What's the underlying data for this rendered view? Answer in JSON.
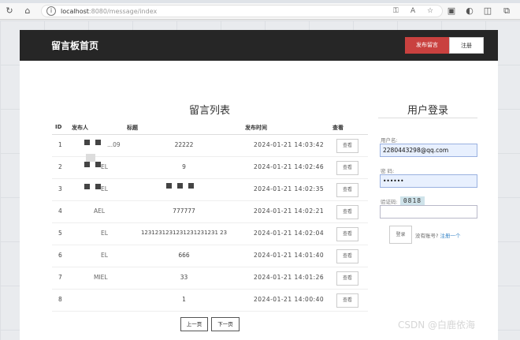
{
  "browser": {
    "url_host": "localhost",
    "url_rest": ":8080/message/index"
  },
  "site": {
    "brand": "留言板首页",
    "post_button": "发布留言",
    "register_button": "注册"
  },
  "list": {
    "title": "留言列表",
    "headers": {
      "id": "ID",
      "user": "发布人",
      "title": "标题",
      "time": "发布时间",
      "view": "查看"
    },
    "rows": [
      {
        "id": "1",
        "user": "...09",
        "title": "22222",
        "time": "2024-01-21 14:03:42",
        "view": "查看"
      },
      {
        "id": "2",
        "user": "EL",
        "title": "9",
        "time": "2024-01-21 14:02:46",
        "view": "查看"
      },
      {
        "id": "3",
        "user": "EL",
        "title": "",
        "time": "2024-01-21 14:02:35",
        "view": "查看"
      },
      {
        "id": "4",
        "user": "AEL",
        "title": "777777",
        "time": "2024-01-21 14:02:21",
        "view": "查看"
      },
      {
        "id": "5",
        "user": "EL",
        "title": "1231231231231231231231 23",
        "time": "2024-01-21 14:02:04",
        "view": "查看"
      },
      {
        "id": "6",
        "user": "EL",
        "title": "666",
        "time": "2024-01-21 14:01:40",
        "view": "查看"
      },
      {
        "id": "7",
        "user": "MIEL",
        "title": "33",
        "time": "2024-01-21 14:01:26",
        "view": "查看"
      },
      {
        "id": "8",
        "user": "",
        "title": "1",
        "time": "2024-01-21 14:00:40",
        "view": "查看"
      }
    ],
    "prev_page": "上一页",
    "next_page": "下一页"
  },
  "login": {
    "title": "用户登录",
    "username_label": "用户名:",
    "username_value": "2280443298@qq.com",
    "password_label": "密 码:",
    "password_value": "••••••",
    "captcha_label": "验证码:",
    "captcha_text": "0818",
    "captcha_value": "",
    "login_button": "登录",
    "no_account_text": "没有账号?",
    "register_link": "注册一个"
  },
  "watermark": "CSDN @白鹿依海"
}
